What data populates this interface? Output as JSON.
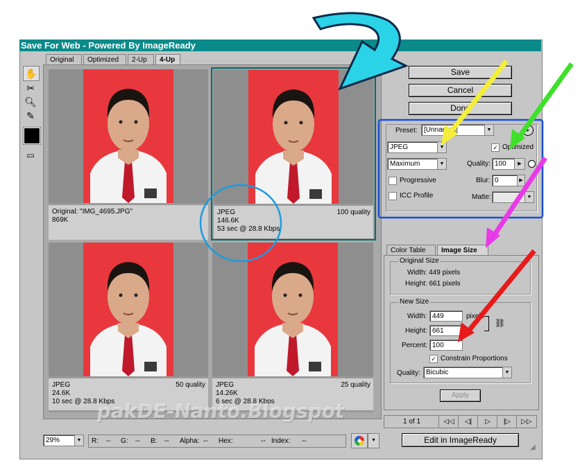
{
  "window": {
    "title": "Save For Web - Powered By ImageReady"
  },
  "tabs": [
    {
      "label": "Original"
    },
    {
      "label": "Optimized"
    },
    {
      "label": "2-Up"
    },
    {
      "label": "4-Up"
    }
  ],
  "panes": [
    {
      "line1": "Original: \"IMG_4695.JPG\"",
      "line2": "869K",
      "line3": "",
      "quality": ""
    },
    {
      "line1": "JPEG",
      "line2": "146.6K",
      "line3": "53 sec @ 28.8 Kbps",
      "quality": "100 quality"
    },
    {
      "line1": "JPEG",
      "line2": "24.6K",
      "line3": "10 sec @ 28.8 Kbps",
      "quality": "50 quality"
    },
    {
      "line1": "JPEG",
      "line2": "14.26K",
      "line3": "6 sec @ 28.8 Kbps",
      "quality": "25 quality"
    }
  ],
  "buttons": {
    "save": "Save",
    "cancel": "Cancel",
    "done": "Done",
    "apply": "Apply",
    "edit": "Edit in ImageReady"
  },
  "settings": {
    "preset_label": "Preset:",
    "preset_value": "[Unnamed]",
    "format": "JPEG",
    "compression": "Maximum",
    "optimized_label": "Optimized",
    "quality_label": "Quality:",
    "quality_value": "100",
    "progressive_label": "Progressive",
    "blur_label": "Blur:",
    "blur_value": "0",
    "icc_label": "ICC Profile",
    "matte_label": "Matte:"
  },
  "panel_tabs": {
    "color_table": "Color Table",
    "image_size": "Image Size"
  },
  "original_size": {
    "title": "Original Size",
    "width": "Width: 449 pixels",
    "height": "Height: 661 pixels"
  },
  "new_size": {
    "title": "New Size",
    "width_label": "Width:",
    "width_value": "449",
    "width_unit": "pixels",
    "height_label": "Height:",
    "height_value": "661",
    "percent_label": "Percent:",
    "percent_value": "100",
    "constrain_label": "Constrain Proportions",
    "quality_label": "Quality:",
    "quality_value": "Bicubic"
  },
  "pager": {
    "text": "1 of 1",
    "first": "◁◁",
    "prev": "◁|",
    "next": "▷",
    "next2": "|▷",
    "last": "▷▷"
  },
  "statusbar": {
    "zoom": "29%",
    "r": "R:",
    "r_val": "--",
    "g": "G:",
    "g_val": "--",
    "b": "B:",
    "b_val": "--",
    "alpha": "Alpha:",
    "alpha_val": "--",
    "hex": "Hex:",
    "hex_val": "--",
    "index": "Index:",
    "index_val": "--"
  },
  "watermark": "pakDE-Nanto.Blogspot",
  "colors": {
    "titlebar": "#0a8a8a",
    "photo_bg": "#e8383d",
    "tie": "#c0192c",
    "blue_box": "#1a4fd6",
    "circle": "#1a9be0",
    "cyan_arrow": "#2ad3e6",
    "yellow_arrow": "#f4ee3a",
    "green_arrow": "#3fe02a",
    "magenta_arrow": "#e83ae8",
    "red_arrow": "#e81a1a"
  }
}
